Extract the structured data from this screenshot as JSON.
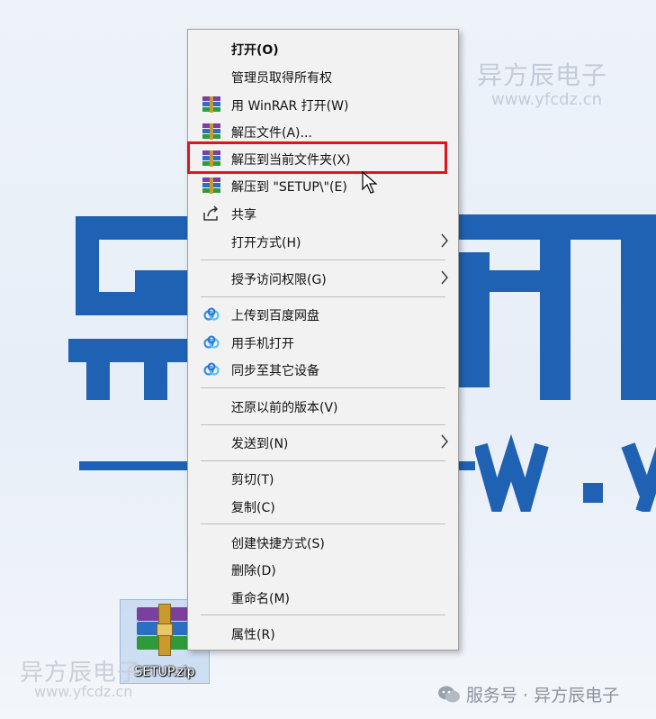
{
  "watermarks": {
    "top_brand": "异方辰电子",
    "top_url": "www.yfcdz.cn",
    "bottom_brand": "异方辰电子",
    "bottom_url": "www.yfcdz.cn",
    "wechat_text": "服务号 · 异方辰电子"
  },
  "desktop": {
    "file_name": "SETUP.zip",
    "file_icon": "winrar-archive-icon"
  },
  "menu": {
    "items": [
      {
        "label": "打开(O)",
        "bold": true,
        "icon": ""
      },
      {
        "label": "管理员取得所有权",
        "icon": ""
      },
      {
        "label": "用 WinRAR 打开(W)",
        "icon": "winrar-icon"
      },
      {
        "label": "解压文件(A)...",
        "icon": "winrar-icon"
      },
      {
        "label": "解压到当前文件夹(X)",
        "icon": "winrar-icon",
        "highlighted": true
      },
      {
        "label": "解压到 \"SETUP\\\"(E)",
        "icon": "winrar-icon"
      },
      {
        "label": "共享",
        "icon": "share-icon"
      },
      {
        "label": "打开方式(H)",
        "icon": "",
        "submenu": true
      },
      {
        "label": "授予访问权限(G)",
        "icon": "",
        "submenu": true
      },
      {
        "label": "上传到百度网盘",
        "icon": "baidu-netdisk-icon"
      },
      {
        "label": "用手机打开",
        "icon": "baidu-netdisk-icon"
      },
      {
        "label": "同步至其它设备",
        "icon": "baidu-netdisk-icon"
      },
      {
        "label": "还原以前的版本(V)",
        "icon": ""
      },
      {
        "label": "发送到(N)",
        "icon": "",
        "submenu": true
      },
      {
        "label": "剪切(T)",
        "icon": ""
      },
      {
        "label": "复制(C)",
        "icon": ""
      },
      {
        "label": "创建快捷方式(S)",
        "icon": ""
      },
      {
        "label": "删除(D)",
        "icon": ""
      },
      {
        "label": "重命名(M)",
        "icon": ""
      },
      {
        "label": "属性(R)",
        "icon": ""
      }
    ]
  },
  "colors": {
    "highlight_border": "#e0141a",
    "brand_blue": "#1f62b3",
    "menu_bg": "#f2f2f2"
  }
}
